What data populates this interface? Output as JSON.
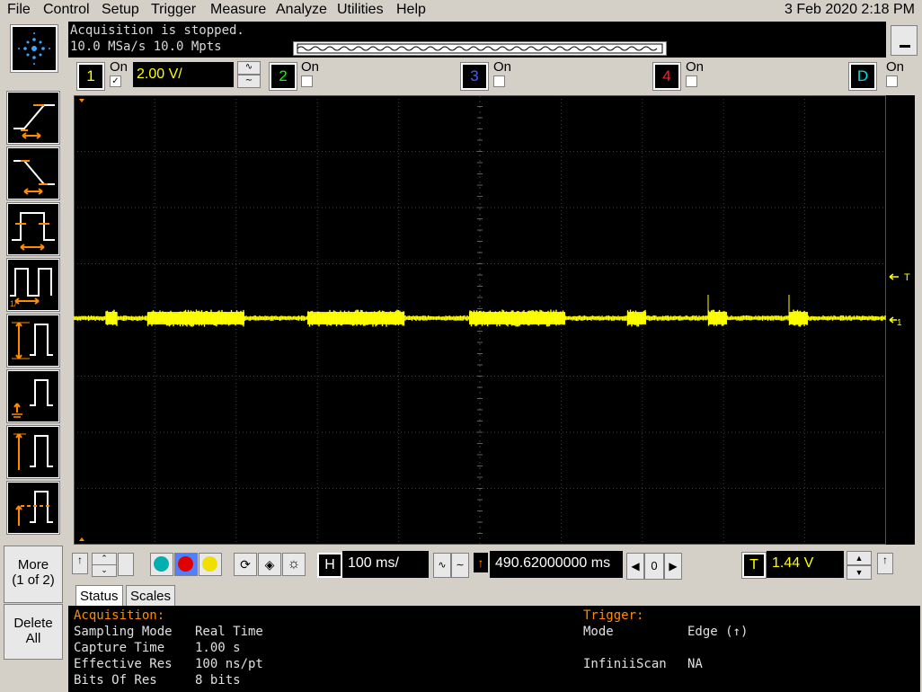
{
  "menu": {
    "items": [
      "File",
      "Control",
      "Setup",
      "Trigger",
      "Measure",
      "Analyze",
      "Utilities",
      "Help"
    ],
    "datetime": "3 Feb 2020  2:18 PM"
  },
  "acquisition_info": {
    "status": "Acquisition is stopped.",
    "rate": "10.0 MSa/s   10.0 Mpts"
  },
  "channels": [
    {
      "number": "1",
      "on_label": "On",
      "enabled": true,
      "color": "#ffff00",
      "scale": "2.00 V/"
    },
    {
      "number": "2",
      "on_label": "On",
      "enabled": false,
      "color": "#00ff00"
    },
    {
      "number": "3",
      "on_label": "On",
      "enabled": false,
      "color": "#4060ff"
    },
    {
      "number": "4",
      "on_label": "On",
      "enabled": false,
      "color": "#ff2020"
    },
    {
      "number": "D",
      "on_label": "On",
      "enabled": false,
      "color": "#00e0e0"
    }
  ],
  "left_toolbar": {
    "tools": [
      "rise-time-icon",
      "fall-time-icon",
      "pulse-width-icon",
      "period-icon",
      "vpp-icon",
      "vmin-icon",
      "vmax-icon",
      "vavg-icon"
    ],
    "more_label": "More",
    "more_page": "(1 of 2)",
    "delete_label": "Delete",
    "delete_all_label": "All"
  },
  "screen": {
    "trigger_marker": "T",
    "ch1_marker": "1",
    "trace_color": "#ffff00"
  },
  "controls": {
    "horizontal_label": "H",
    "time_scale": "100 ms/",
    "delay_marker": "↑",
    "delay": "490.62000000 ms",
    "zero_label": "0",
    "trigger_label": "T",
    "trigger_level": "1.44 V"
  },
  "tabs": [
    "Status",
    "Scales"
  ],
  "status": {
    "acquisition_header": "Acquisition:",
    "trigger_header": "Trigger:",
    "rows": [
      {
        "label": "Sampling Mode",
        "value": "Real Time"
      },
      {
        "label": "Capture Time",
        "value": "1.00 s"
      },
      {
        "label": "Effective Res",
        "value": "100 ns/pt"
      },
      {
        "label": "Bits Of Res",
        "value": "8 bits"
      }
    ],
    "trigger_rows": [
      {
        "label": "Mode",
        "value": "Edge (↑)"
      },
      {
        "label": "InfiniiScan",
        "value": "NA"
      }
    ]
  }
}
